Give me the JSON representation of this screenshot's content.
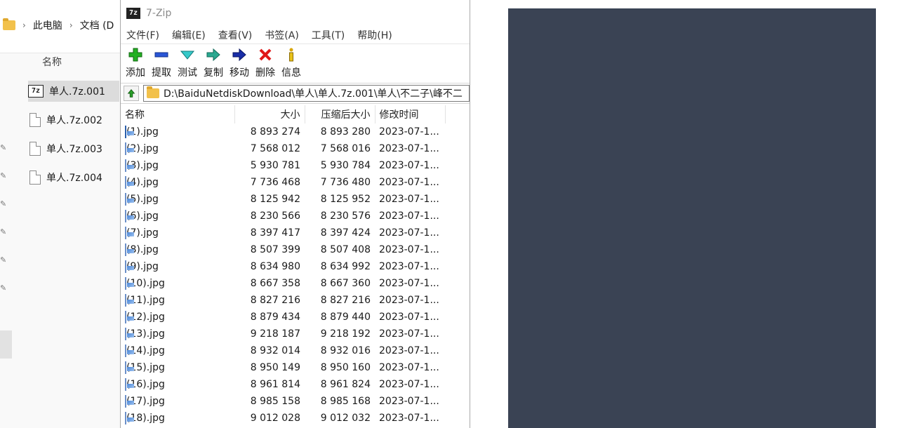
{
  "explorer": {
    "breadcrumb": [
      "此电脑",
      "文档 (D"
    ],
    "column_header": "名称",
    "files": [
      "单人.7z.001",
      "单人.7z.002",
      "单人.7z.003",
      "单人.7z.004"
    ],
    "selected_index": 0
  },
  "sevenzip": {
    "title": "7-Zip",
    "menu": [
      "文件(F)",
      "编辑(E)",
      "查看(V)",
      "书签(A)",
      "工具(T)",
      "帮助(H)"
    ],
    "toolbar": [
      {
        "label": "添加",
        "icon": "add-icon"
      },
      {
        "label": "提取",
        "icon": "extract-icon"
      },
      {
        "label": "测试",
        "icon": "test-icon"
      },
      {
        "label": "复制",
        "icon": "copy-icon"
      },
      {
        "label": "移动",
        "icon": "move-icon"
      },
      {
        "label": "删除",
        "icon": "delete-icon"
      },
      {
        "label": "信息",
        "icon": "info-icon"
      }
    ],
    "path": "D:\\BaiduNetdiskDownload\\单人\\单人.7z.001\\单人\\不二子\\峰不二",
    "columns": [
      "名称",
      "大小",
      "压缩后大小",
      "修改时间"
    ],
    "rows": [
      {
        "name": "(1).jpg",
        "size": "8 893 274",
        "packed": "8 893 280",
        "modified": "2023-07-1..."
      },
      {
        "name": "(2).jpg",
        "size": "7 568 012",
        "packed": "7 568 016",
        "modified": "2023-07-1..."
      },
      {
        "name": "(3).jpg",
        "size": "5 930 781",
        "packed": "5 930 784",
        "modified": "2023-07-1..."
      },
      {
        "name": "(4).jpg",
        "size": "7 736 468",
        "packed": "7 736 480",
        "modified": "2023-07-1..."
      },
      {
        "name": "(5).jpg",
        "size": "8 125 942",
        "packed": "8 125 952",
        "modified": "2023-07-1..."
      },
      {
        "name": "(6).jpg",
        "size": "8 230 566",
        "packed": "8 230 576",
        "modified": "2023-07-1..."
      },
      {
        "name": "(7).jpg",
        "size": "8 397 417",
        "packed": "8 397 424",
        "modified": "2023-07-1..."
      },
      {
        "name": "(8).jpg",
        "size": "8 507 399",
        "packed": "8 507 408",
        "modified": "2023-07-1..."
      },
      {
        "name": "(9).jpg",
        "size": "8 634 980",
        "packed": "8 634 992",
        "modified": "2023-07-1..."
      },
      {
        "name": "(10).jpg",
        "size": "8 667 358",
        "packed": "8 667 360",
        "modified": "2023-07-1..."
      },
      {
        "name": "(11).jpg",
        "size": "8 827 216",
        "packed": "8 827 216",
        "modified": "2023-07-1..."
      },
      {
        "name": "(12).jpg",
        "size": "8 879 434",
        "packed": "8 879 440",
        "modified": "2023-07-1..."
      },
      {
        "name": "(13).jpg",
        "size": "9 218 187",
        "packed": "9 218 192",
        "modified": "2023-07-1..."
      },
      {
        "name": "(14).jpg",
        "size": "8 932 014",
        "packed": "8 932 016",
        "modified": "2023-07-1..."
      },
      {
        "name": "(15).jpg",
        "size": "8 950 149",
        "packed": "8 950 160",
        "modified": "2023-07-1..."
      },
      {
        "name": "(16).jpg",
        "size": "8 961 814",
        "packed": "8 961 824",
        "modified": "2023-07-1..."
      },
      {
        "name": "(17).jpg",
        "size": "8 985 158",
        "packed": "8 985 168",
        "modified": "2023-07-1..."
      },
      {
        "name": "(18).jpg",
        "size": "9 012 028",
        "packed": "9 012 032",
        "modified": "2023-07-1..."
      }
    ]
  },
  "preview": {
    "background": "#3a4354"
  }
}
